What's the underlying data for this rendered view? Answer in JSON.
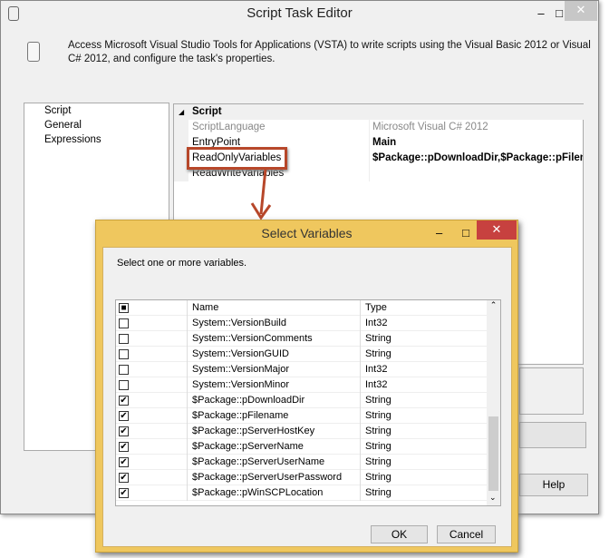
{
  "main": {
    "title": "Script Task Editor",
    "description": "Access Microsoft Visual Studio Tools for Applications (VSTA) to write scripts using the Visual Basic 2012 or Visual C# 2012, and configure the task's properties.",
    "nav": [
      "Script",
      "General",
      "Expressions"
    ],
    "grid": {
      "category": "Script",
      "rows": [
        {
          "key": "ScriptLanguage",
          "value": "Microsoft Visual C# 2012"
        },
        {
          "key": "EntryPoint",
          "value": "Main"
        },
        {
          "key": "ReadOnlyVariables",
          "value": "$Package::pDownloadDir,$Package::pFilename,$"
        },
        {
          "key": "ReadWriteVariables",
          "value": ""
        }
      ]
    },
    "help": "Help",
    "minimize": "–",
    "maximize": "□",
    "close": "✕"
  },
  "dialog": {
    "title": "Select Variables",
    "instruction": "Select one or more variables.",
    "minimize": "–",
    "maximize": "□",
    "close": "✕",
    "columns": [
      "Name",
      "Type"
    ],
    "rows": [
      {
        "name": "System::VersionBuild",
        "type": "Int32",
        "checked": false
      },
      {
        "name": "System::VersionComments",
        "type": "String",
        "checked": false
      },
      {
        "name": "System::VersionGUID",
        "type": "String",
        "checked": false
      },
      {
        "name": "System::VersionMajor",
        "type": "Int32",
        "checked": false
      },
      {
        "name": "System::VersionMinor",
        "type": "Int32",
        "checked": false
      },
      {
        "name": "$Package::pDownloadDir",
        "type": "String",
        "checked": true
      },
      {
        "name": "$Package::pFilename",
        "type": "String",
        "checked": true
      },
      {
        "name": "$Package::pServerHostKey",
        "type": "String",
        "checked": true
      },
      {
        "name": "$Package::pServerName",
        "type": "String",
        "checked": true
      },
      {
        "name": "$Package::pServerUserName",
        "type": "String",
        "checked": true
      },
      {
        "name": "$Package::pServerUserPassword",
        "type": "String",
        "checked": true
      },
      {
        "name": "$Package::pWinSCPLocation",
        "type": "String",
        "checked": true
      }
    ],
    "ok": "OK",
    "cancel": "Cancel"
  },
  "colors": {
    "accent": "#efc75e",
    "highlight": "#b7472a",
    "close": "#c7413f"
  }
}
